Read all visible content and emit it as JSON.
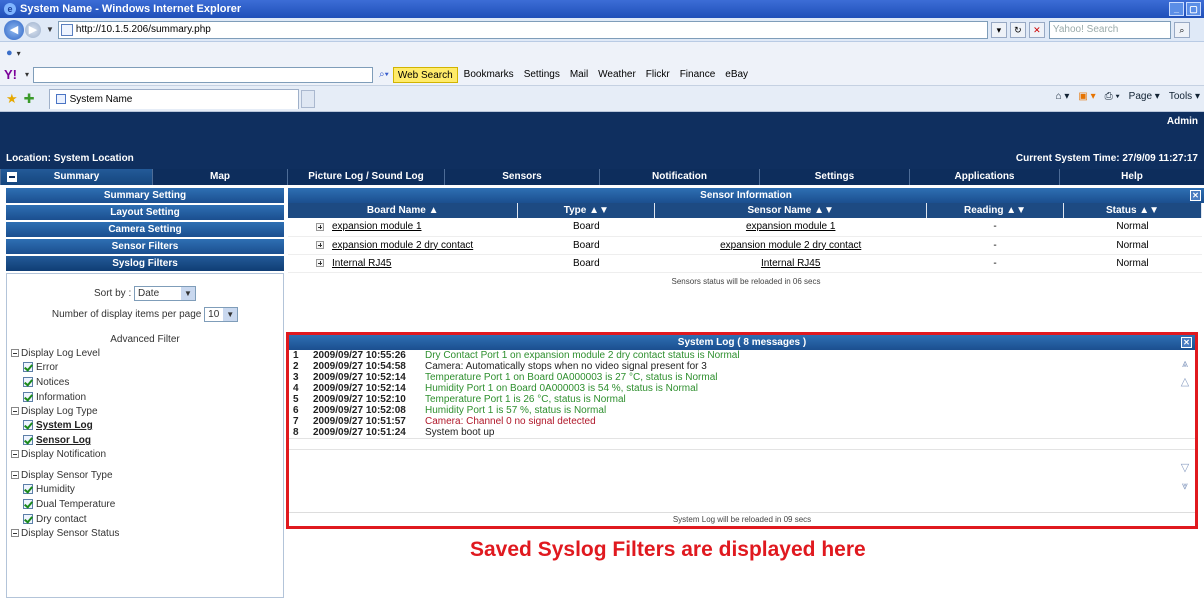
{
  "browser": {
    "window_title": "System Name - Windows Internet Explorer",
    "url": "http://10.1.5.206/summary.php",
    "search_placeholder": "Yahoo! Search",
    "tab_title": "System Name",
    "toolbar": {
      "web_search": "Web Search",
      "bookmarks": "Bookmarks",
      "settings": "Settings",
      "mail": "Mail",
      "weather": "Weather",
      "flickr": "Flickr",
      "finance": "Finance",
      "ebay": "eBay"
    },
    "right_cmds": {
      "page": "Page",
      "tools": "Tools"
    }
  },
  "header": {
    "user": "Admin",
    "location": "Location: System Location",
    "system_time": "Current System Time: 27/9/09 11:27:17"
  },
  "tabs": [
    {
      "label": "Summary"
    },
    {
      "label": "Map"
    },
    {
      "label": "Picture Log / Sound Log"
    },
    {
      "label": "Sensors"
    },
    {
      "label": "Notification"
    },
    {
      "label": "Settings"
    },
    {
      "label": "Applications"
    },
    {
      "label": "Help"
    }
  ],
  "sidebar": {
    "buttons": [
      {
        "label": "Summary Setting"
      },
      {
        "label": "Layout Setting"
      },
      {
        "label": "Camera Setting"
      },
      {
        "label": "Sensor Filters"
      },
      {
        "label": "Syslog Filters"
      }
    ],
    "sort_by_label": "Sort by :",
    "sort_by_value": "Date",
    "items_per_page_label": "Number of display items per page",
    "items_per_page_value": "10",
    "advanced_filter": "Advanced Filter",
    "log_level_title": "Display Log Level",
    "log_levels": [
      "Error",
      "Notices",
      "Information"
    ],
    "log_type_title": "Display Log Type",
    "log_types": [
      "System Log",
      "Sensor Log"
    ],
    "notification_title": "Display Notification",
    "sensor_type_title": "Display Sensor Type",
    "sensor_types": [
      "Humidity",
      "Dual Temperature",
      "Dry contact"
    ],
    "sensor_status_title": "Display Sensor Status"
  },
  "sensor_panel": {
    "title": "Sensor Information",
    "columns": [
      "Board Name ▲",
      "Type ▲▼",
      "Sensor Name ▲▼",
      "Reading ▲▼",
      "Status ▲▼"
    ],
    "rows": [
      {
        "board": "expansion module 1",
        "type": "Board",
        "sensor": "expansion module 1",
        "reading": "-",
        "status": "Normal"
      },
      {
        "board": "expansion module 2 dry contact",
        "type": "Board",
        "sensor": "expansion module 2 dry contact",
        "reading": "-",
        "status": "Normal"
      },
      {
        "board": "Internal RJ45",
        "type": "Board",
        "sensor": "Internal RJ45",
        "reading": "-",
        "status": "Normal"
      }
    ],
    "reload_note": "Sensors status will be reloaded in 06 secs"
  },
  "system_log": {
    "title": "System Log ( 8 messages )",
    "entries": [
      {
        "n": "1",
        "ts": "2009/09/27 10:55:26",
        "msg": "Dry Contact Port 1 on expansion module 2 dry contact status is Normal",
        "color": "#2e8f2e"
      },
      {
        "n": "2",
        "ts": "2009/09/27 10:54:58",
        "msg": "Camera: Automatically stops when no video signal present for 3",
        "color": "#222222"
      },
      {
        "n": "3",
        "ts": "2009/09/27 10:52:14",
        "msg": "Temperature Port 1 on Board 0A000003 is 27 °C, status is Normal",
        "color": "#2e8f2e"
      },
      {
        "n": "4",
        "ts": "2009/09/27 10:52:14",
        "msg": "Humidity Port 1 on Board 0A000003 is 54 %, status is Normal",
        "color": "#2e8f2e"
      },
      {
        "n": "5",
        "ts": "2009/09/27 10:52:10",
        "msg": "Temperature Port 1 is 26 °C, status is Normal",
        "color": "#2e8f2e"
      },
      {
        "n": "6",
        "ts": "2009/09/27 10:52:08",
        "msg": "Humidity Port 1 is 57 %, status is Normal",
        "color": "#2e8f2e"
      },
      {
        "n": "7",
        "ts": "2009/09/27 10:51:57",
        "msg": "Camera: Channel 0 no signal detected",
        "color": "#b0182a"
      },
      {
        "n": "8",
        "ts": "2009/09/27 10:51:24",
        "msg": "System boot up",
        "color": "#222222"
      }
    ],
    "reload_note": "System Log will be reloaded in 09 secs"
  },
  "caption": "Saved Syslog Filters are displayed here"
}
